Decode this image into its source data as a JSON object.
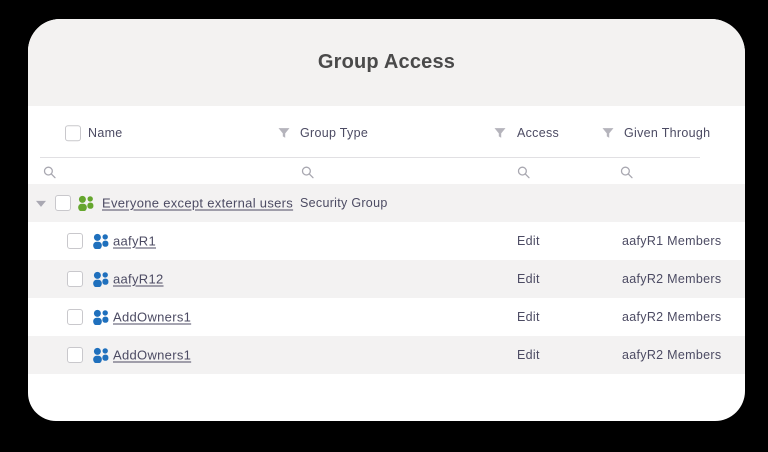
{
  "title": "Group Access",
  "colors": {
    "background": "#000000",
    "card": "#ffffff",
    "header_band": "#f3f2f1",
    "row_stripe": "#f3f2f2",
    "text": "#4c4b63",
    "title_text": "#4a4a4a",
    "green_group_icon": "#65a62e",
    "blue_group_icon": "#1f70bd"
  },
  "table": {
    "columns": {
      "name": "Name",
      "group_type": "Group Type",
      "access": "Access",
      "given_through": "Given Through"
    },
    "rows": [
      {
        "name": "Everyone except external users",
        "group_type": "Security Group",
        "access": "",
        "given_through": "",
        "icon": "people-icon-green",
        "expanded": true,
        "level": 0
      },
      {
        "name": "aafyR1",
        "group_type": "",
        "access": "Edit",
        "given_through": "aafyR1 Members",
        "icon": "people-icon-blue",
        "level": 1
      },
      {
        "name": "aafyR12",
        "group_type": "",
        "access": "Edit",
        "given_through": "aafyR2 Members",
        "icon": "people-icon-blue",
        "level": 1
      },
      {
        "name": "AddOwners1",
        "group_type": "",
        "access": "Edit",
        "given_through": "aafyR2 Members",
        "icon": "people-icon-blue",
        "level": 1
      },
      {
        "name": "AddOwners1",
        "group_type": "",
        "access": "Edit",
        "given_through": "aafyR2 Members",
        "icon": "people-icon-blue",
        "level": 1
      }
    ]
  }
}
